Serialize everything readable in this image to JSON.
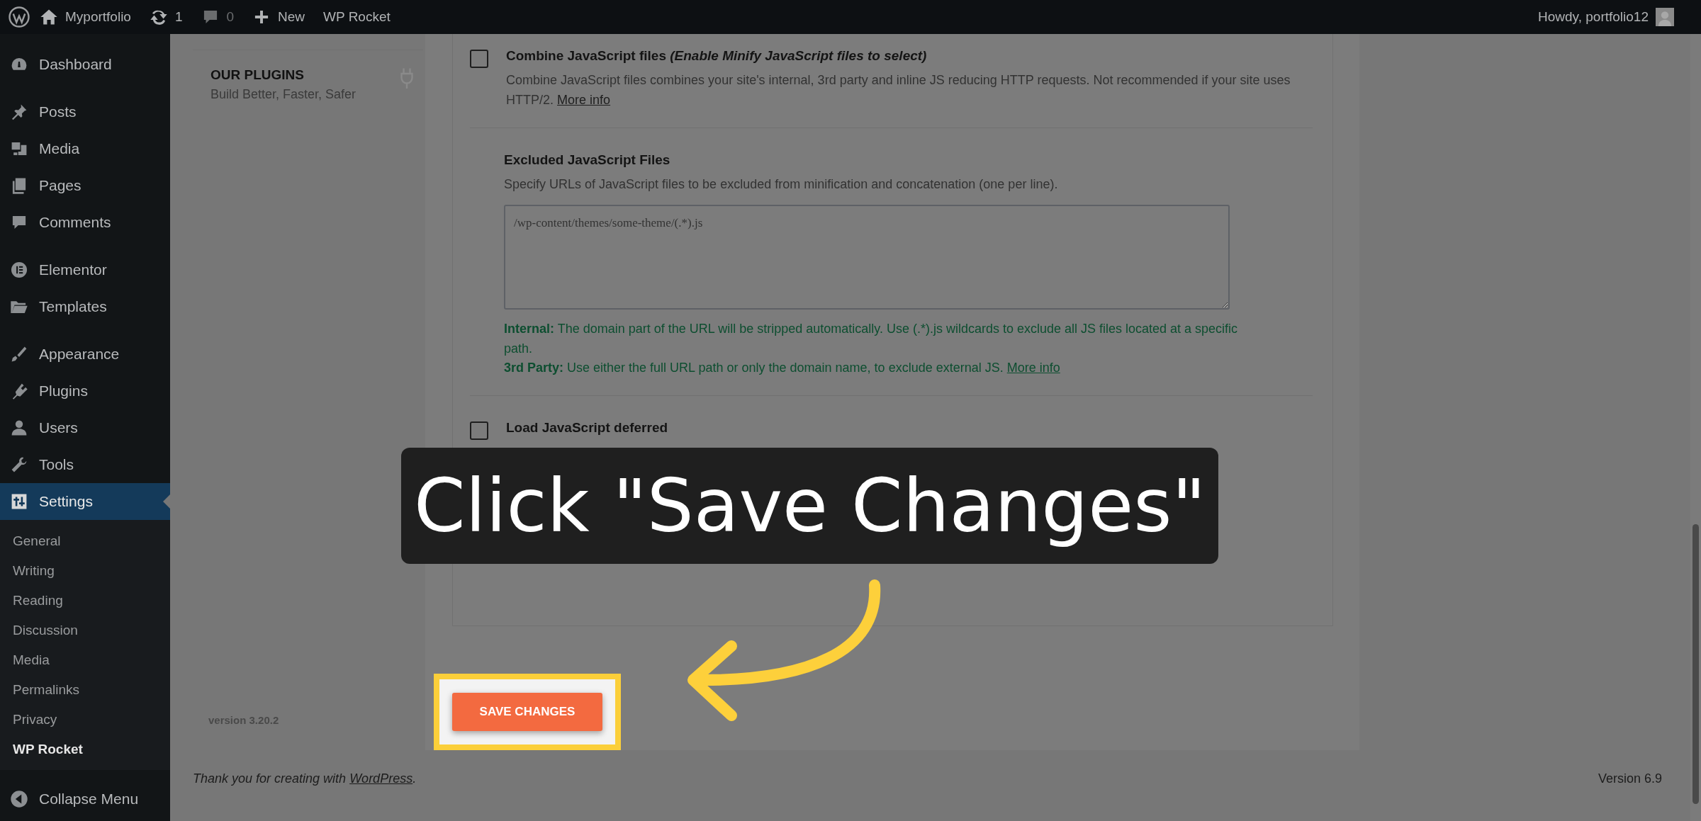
{
  "top_bar": {
    "site_name": "Myportfolio",
    "updates": "1",
    "comments": "0",
    "new_label": "New",
    "plugin": "WP Rocket",
    "greeting": "Howdy, portfolio12"
  },
  "sidebar": {
    "groups": [
      [
        {
          "label": "Dashboard",
          "selected": false
        }
      ],
      [
        {
          "label": "Posts",
          "selected": false
        },
        {
          "label": "Media",
          "selected": false
        },
        {
          "label": "Pages",
          "selected": false
        },
        {
          "label": "Comments",
          "selected": false
        }
      ],
      [
        {
          "label": "Elementor",
          "selected": false
        },
        {
          "label": "Templates",
          "selected": false
        }
      ],
      [
        {
          "label": "Appearance",
          "selected": false
        },
        {
          "label": "Plugins",
          "selected": false
        },
        {
          "label": "Users",
          "selected": false
        },
        {
          "label": "Tools",
          "selected": false
        },
        {
          "label": "Settings",
          "selected": true,
          "children": [
            {
              "label": "General",
              "selected": false
            },
            {
              "label": "Writing",
              "selected": false
            },
            {
              "label": "Reading",
              "selected": false
            },
            {
              "label": "Discussion",
              "selected": false
            },
            {
              "label": "Media",
              "selected": false
            },
            {
              "label": "Permalinks",
              "selected": false
            },
            {
              "label": "Privacy",
              "selected": false
            },
            {
              "label": "WP Rocket",
              "selected": true
            }
          ]
        }
      ]
    ],
    "collapse": "Collapse Menu"
  },
  "left_panel": {
    "title": "OUR PLUGINS",
    "subtitle": "Build Better, Faster, Safer",
    "version": "version 3.20.2"
  },
  "options": [
    {
      "kind": "checkbox",
      "checked": false,
      "title": "Combine JavaScript files *(Enable Minify JavaScript files to select)*",
      "description": "Combine JavaScript files combines your site's internal, 3rd party and inline JS reducing HTTP requests. Not recommended if your site uses HTTP/2.",
      "link": "More info"
    },
    {
      "kind": "field",
      "title": "Excluded JavaScript Files",
      "description": "Specify URLs of JavaScript files to be excluded from minification and concatenation (one per line).",
      "value": "/wp-content/themes/some-theme/(.*).js",
      "help": [
        {
          "text": "**Internal:** The domain part of the URL will be stripped automatically. Use (.*).js wildcards to exclude all JS files located at a specific path."
        },
        {
          "text": "**3rd Party:** Use either the full URL path or only the domain name, to exclude external JS.",
          "link": "More info"
        }
      ]
    },
    {
      "kind": "checkbox",
      "checked": false,
      "title": "Load JavaScript deferred"
    }
  ],
  "save_button": "SAVE CHANGES",
  "callout": "Click \"Save Changes\"",
  "footer": {
    "text": "Thank you for creating with",
    "link": "WordPress",
    "after": ".",
    "version": "Version 6.9"
  }
}
